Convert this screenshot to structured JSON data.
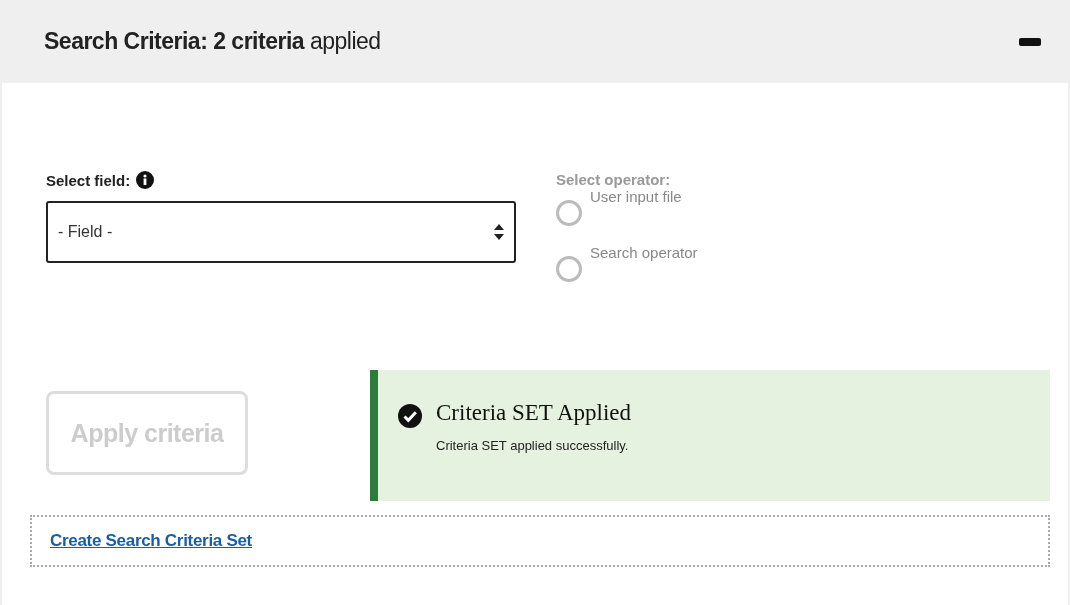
{
  "panel": {
    "title": "**Search Criteria: 2 criteria** applied",
    "expanded": true
  },
  "field_select": {
    "label": "Select field:",
    "value": "- Field -"
  },
  "operator": {
    "label": "Select operator:",
    "disabled": true,
    "options": [
      {
        "label": "User input file",
        "selected": false
      },
      {
        "label": "Search operator",
        "selected": false
      }
    ]
  },
  "apply_button": {
    "label": "Apply criteria",
    "disabled": true
  },
  "alert": {
    "title": "Criteria SET Applied",
    "message": "Criteria SET applied successfully."
  },
  "create_link": "Create Search Criteria Set"
}
